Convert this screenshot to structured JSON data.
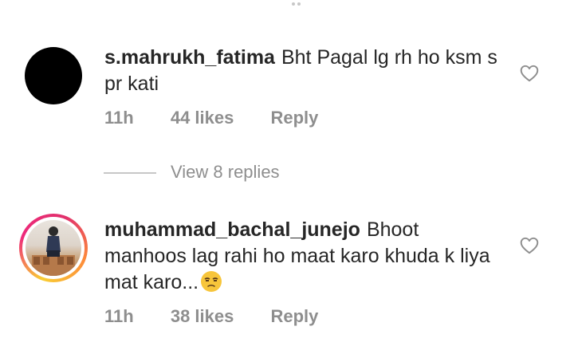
{
  "comments": [
    {
      "username": "s.mahrukh_fatima",
      "text": "Bht Pagal lg rh ho ksm s pr kati",
      "time": "11h",
      "likes": "44 likes",
      "reply_label": "Reply",
      "avatar_color": "#000000"
    },
    {
      "username": "muhammad_bachal_junejo",
      "text": "Bhoot manhoos lag rahi ho maat karo khuda k liya mat karo...",
      "emoji": "unamused-face-emoji",
      "time": "11h",
      "likes": "38 likes",
      "reply_label": "Reply",
      "avatar_ring_colors": [
        "#f9ce34",
        "#ee2a7b",
        "#fd8a3a"
      ]
    }
  ],
  "view_replies": {
    "label": "View 8 replies"
  },
  "icons": {
    "like": "heart-outline-icon"
  },
  "colors": {
    "text": "#262626",
    "secondary": "#8e8e8e",
    "divider": "#c7c7c7"
  }
}
